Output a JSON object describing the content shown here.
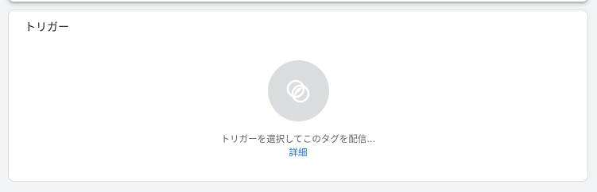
{
  "card": {
    "title": "トリガー"
  },
  "empty_state": {
    "icon": "trigger-overlap-circles-icon",
    "hint": "トリガーを選択してこのタグを配信...",
    "learn_more": "詳細"
  },
  "colors": {
    "page_background": "#f1f3f4",
    "card_background": "#ffffff",
    "icon_circle": "#dadce0",
    "hint_text": "#5f6368",
    "link": "#1967d2"
  }
}
